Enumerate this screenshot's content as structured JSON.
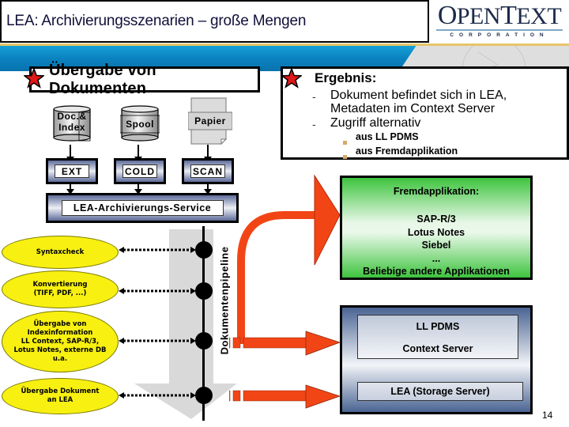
{
  "header": {
    "title": "LEA: Archivierungsszenarien – große Mengen",
    "logo": {
      "brand_first": "O",
      "brand_word1": "PEN",
      "brand_second": "T",
      "brand_word2": "EXT",
      "subline": "CORPORATION"
    }
  },
  "colors": {
    "banner_blue": "#0a82c0",
    "banner_gold": "#e7c46b",
    "star_red": "#e01818",
    "ellipse_yellow": "#f7f011",
    "fremd_green": "#3ec43e",
    "server_blue": "#4a6493",
    "arrow_red": "#f24516"
  },
  "left_section": {
    "title": "Übergabe von Dokumenten",
    "sources": [
      {
        "label_line1": "Doc.&",
        "label_line2": "Index",
        "icon": "database-cylinder-icon",
        "target": "EXT"
      },
      {
        "label_line1": "Spool",
        "label_line2": "",
        "icon": "database-cylinder-icon",
        "target": "COLD"
      },
      {
        "label_line1": "Papier",
        "label_line2": "",
        "icon": "paper-document-icon",
        "target": "SCAN"
      }
    ],
    "service": "LEA-Archivierungs-Service",
    "pipeline_label": "Dokumentenpipeline",
    "steps": [
      {
        "lines": [
          "Syntaxcheck"
        ]
      },
      {
        "lines": [
          "Konvertierung",
          "(TIFF, PDF, ...)"
        ]
      },
      {
        "lines": [
          "Übergabe von",
          "Indexinformation",
          "LL Context, SAP-R/3,",
          "Lotus Notes, externe DB",
          "u.a."
        ]
      },
      {
        "lines": [
          "Übergabe Dokument",
          "an LEA"
        ]
      }
    ]
  },
  "ergebnis": {
    "title": "Ergebnis:",
    "items": [
      {
        "dash": "-",
        "line1": "Dokument befindet sich in LEA,",
        "line2": "Metadaten im Context Server"
      },
      {
        "dash": "-",
        "line1": "Zugriff alternativ",
        "line2": ""
      }
    ],
    "sub_items": [
      "aus LL PDMS",
      "aus Fremdapplikation"
    ]
  },
  "fremdapplikation": {
    "header": "Fremdapplikation:",
    "apps": [
      "SAP-R/3",
      "Lotus Notes",
      "Siebel",
      "...",
      "Beliebige andere Applikationen"
    ]
  },
  "server": {
    "upper_line1": "LL PDMS",
    "upper_line2": "Context Server",
    "lower": "LEA (Storage Server)"
  },
  "page_number": "14"
}
